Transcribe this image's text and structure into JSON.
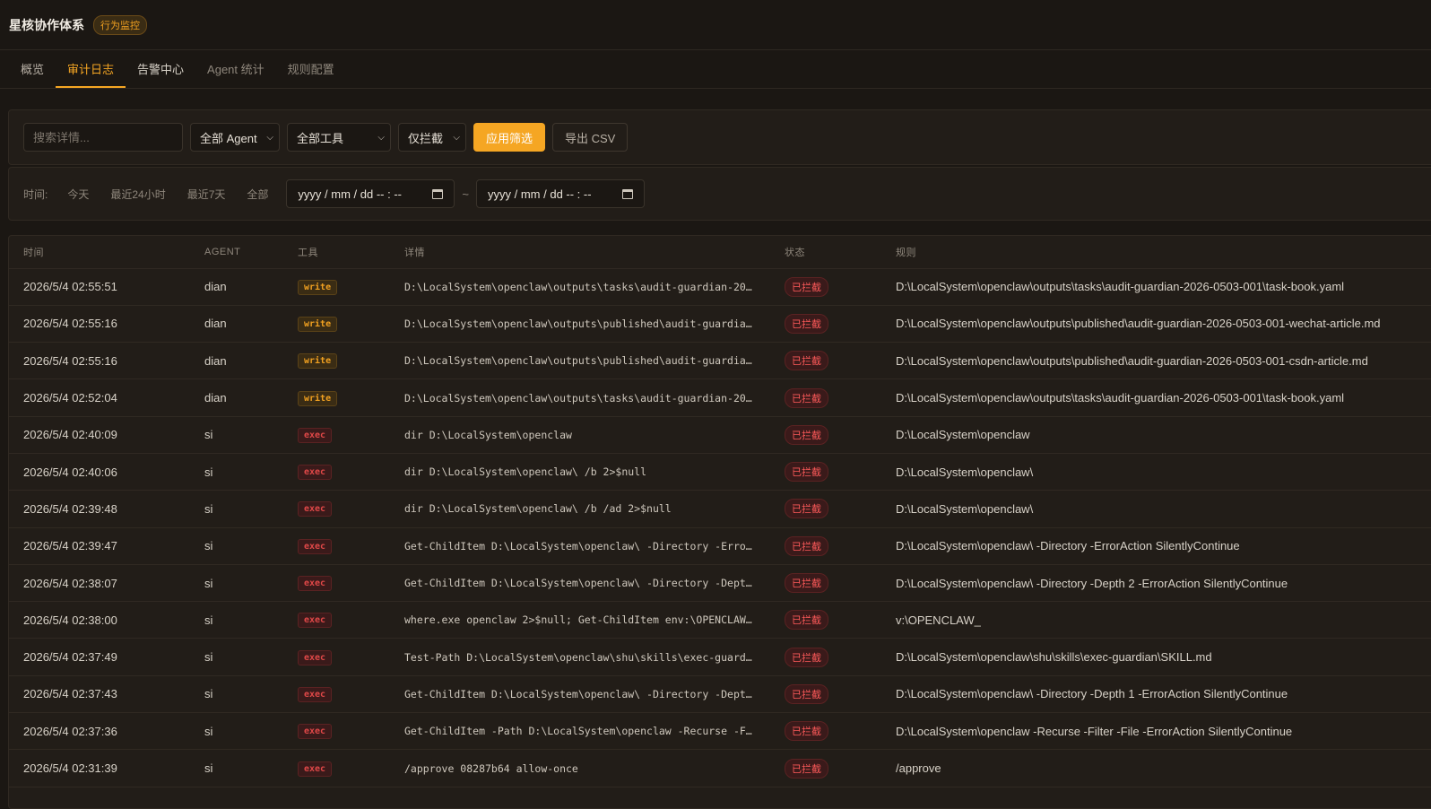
{
  "header": {
    "title": "星核协作体系",
    "badge": "行为监控"
  },
  "tabs": [
    {
      "label": "概览"
    },
    {
      "label": "审计日志"
    },
    {
      "label": "告警中心"
    },
    {
      "label": "Agent 统计"
    },
    {
      "label": "规则配置"
    }
  ],
  "filters": {
    "search_placeholder": "搜索详情...",
    "agent_select": "全部 Agent",
    "tool_select": "全部工具",
    "blocked_select": "仅拦截",
    "apply_label": "应用筛选",
    "export_label": "导出 CSV"
  },
  "time": {
    "label": "时间:",
    "quick": [
      "今天",
      "最近24小时",
      "最近7天",
      "全部"
    ],
    "start": "yyyy / mm / dd  -- : --",
    "tilde": "~",
    "end": "yyyy / mm / dd  -- : --"
  },
  "table": {
    "headers": [
      "时间",
      "AGENT",
      "工具",
      "详情",
      "状态",
      "规则"
    ],
    "rows": [
      {
        "time": "2026/5/4 02:55:51",
        "agent": "dian",
        "tool": "write",
        "detail": "D:\\LocalSystem\\openclaw\\outputs\\tasks\\audit-guardian-20…",
        "status": "已拦截",
        "rule": "D:\\LocalSystem\\openclaw\\outputs\\tasks\\audit-guardian-2026-0503-001\\task-book.yaml"
      },
      {
        "time": "2026/5/4 02:55:16",
        "agent": "dian",
        "tool": "write",
        "detail": "D:\\LocalSystem\\openclaw\\outputs\\published\\audit-guardia…",
        "status": "已拦截",
        "rule": "D:\\LocalSystem\\openclaw\\outputs\\published\\audit-guardian-2026-0503-001-wechat-article.md"
      },
      {
        "time": "2026/5/4 02:55:16",
        "agent": "dian",
        "tool": "write",
        "detail": "D:\\LocalSystem\\openclaw\\outputs\\published\\audit-guardia…",
        "status": "已拦截",
        "rule": "D:\\LocalSystem\\openclaw\\outputs\\published\\audit-guardian-2026-0503-001-csdn-article.md"
      },
      {
        "time": "2026/5/4 02:52:04",
        "agent": "dian",
        "tool": "write",
        "detail": "D:\\LocalSystem\\openclaw\\outputs\\tasks\\audit-guardian-20…",
        "status": "已拦截",
        "rule": "D:\\LocalSystem\\openclaw\\outputs\\tasks\\audit-guardian-2026-0503-001\\task-book.yaml"
      },
      {
        "time": "2026/5/4 02:40:09",
        "agent": "si",
        "tool": "exec",
        "detail": "dir D:\\LocalSystem\\openclaw",
        "status": "已拦截",
        "rule": "D:\\LocalSystem\\openclaw"
      },
      {
        "time": "2026/5/4 02:40:06",
        "agent": "si",
        "tool": "exec",
        "detail": "dir D:\\LocalSystem\\openclaw\\ /b 2>$null",
        "status": "已拦截",
        "rule": "D:\\LocalSystem\\openclaw\\"
      },
      {
        "time": "2026/5/4 02:39:48",
        "agent": "si",
        "tool": "exec",
        "detail": "dir D:\\LocalSystem\\openclaw\\ /b /ad 2>$null",
        "status": "已拦截",
        "rule": "D:\\LocalSystem\\openclaw\\"
      },
      {
        "time": "2026/5/4 02:39:47",
        "agent": "si",
        "tool": "exec",
        "detail": "Get-ChildItem D:\\LocalSystem\\openclaw\\ -Directory -Erro…",
        "status": "已拦截",
        "rule": "D:\\LocalSystem\\openclaw\\ -Directory -ErrorAction SilentlyContinue"
      },
      {
        "time": "2026/5/4 02:38:07",
        "agent": "si",
        "tool": "exec",
        "detail": "Get-ChildItem D:\\LocalSystem\\openclaw\\ -Directory -Dept…",
        "status": "已拦截",
        "rule": "D:\\LocalSystem\\openclaw\\ -Directory -Depth 2 -ErrorAction SilentlyContinue"
      },
      {
        "time": "2026/5/4 02:38:00",
        "agent": "si",
        "tool": "exec",
        "detail": "where.exe openclaw 2>$null; Get-ChildItem env:\\OPENCLAW…",
        "status": "已拦截",
        "rule": "v:\\OPENCLAW_"
      },
      {
        "time": "2026/5/4 02:37:49",
        "agent": "si",
        "tool": "exec",
        "detail": "Test-Path D:\\LocalSystem\\openclaw\\shu\\skills\\exec-guard…",
        "status": "已拦截",
        "rule": "D:\\LocalSystem\\openclaw\\shu\\skills\\exec-guardian\\SKILL.md"
      },
      {
        "time": "2026/5/4 02:37:43",
        "agent": "si",
        "tool": "exec",
        "detail": "Get-ChildItem D:\\LocalSystem\\openclaw\\ -Directory -Dept…",
        "status": "已拦截",
        "rule": "D:\\LocalSystem\\openclaw\\ -Directory -Depth 1 -ErrorAction SilentlyContinue"
      },
      {
        "time": "2026/5/4 02:37:36",
        "agent": "si",
        "tool": "exec",
        "detail": "Get-ChildItem -Path D:\\LocalSystem\\openclaw -Recurse -F…",
        "status": "已拦截",
        "rule": "D:\\LocalSystem\\openclaw -Recurse -Filter -File -ErrorAction SilentlyContinue"
      },
      {
        "time": "2026/5/4 02:31:39",
        "agent": "si",
        "tool": "exec",
        "detail": "/approve 08287b64 allow-once",
        "status": "已拦截",
        "rule": "/approve"
      }
    ]
  }
}
